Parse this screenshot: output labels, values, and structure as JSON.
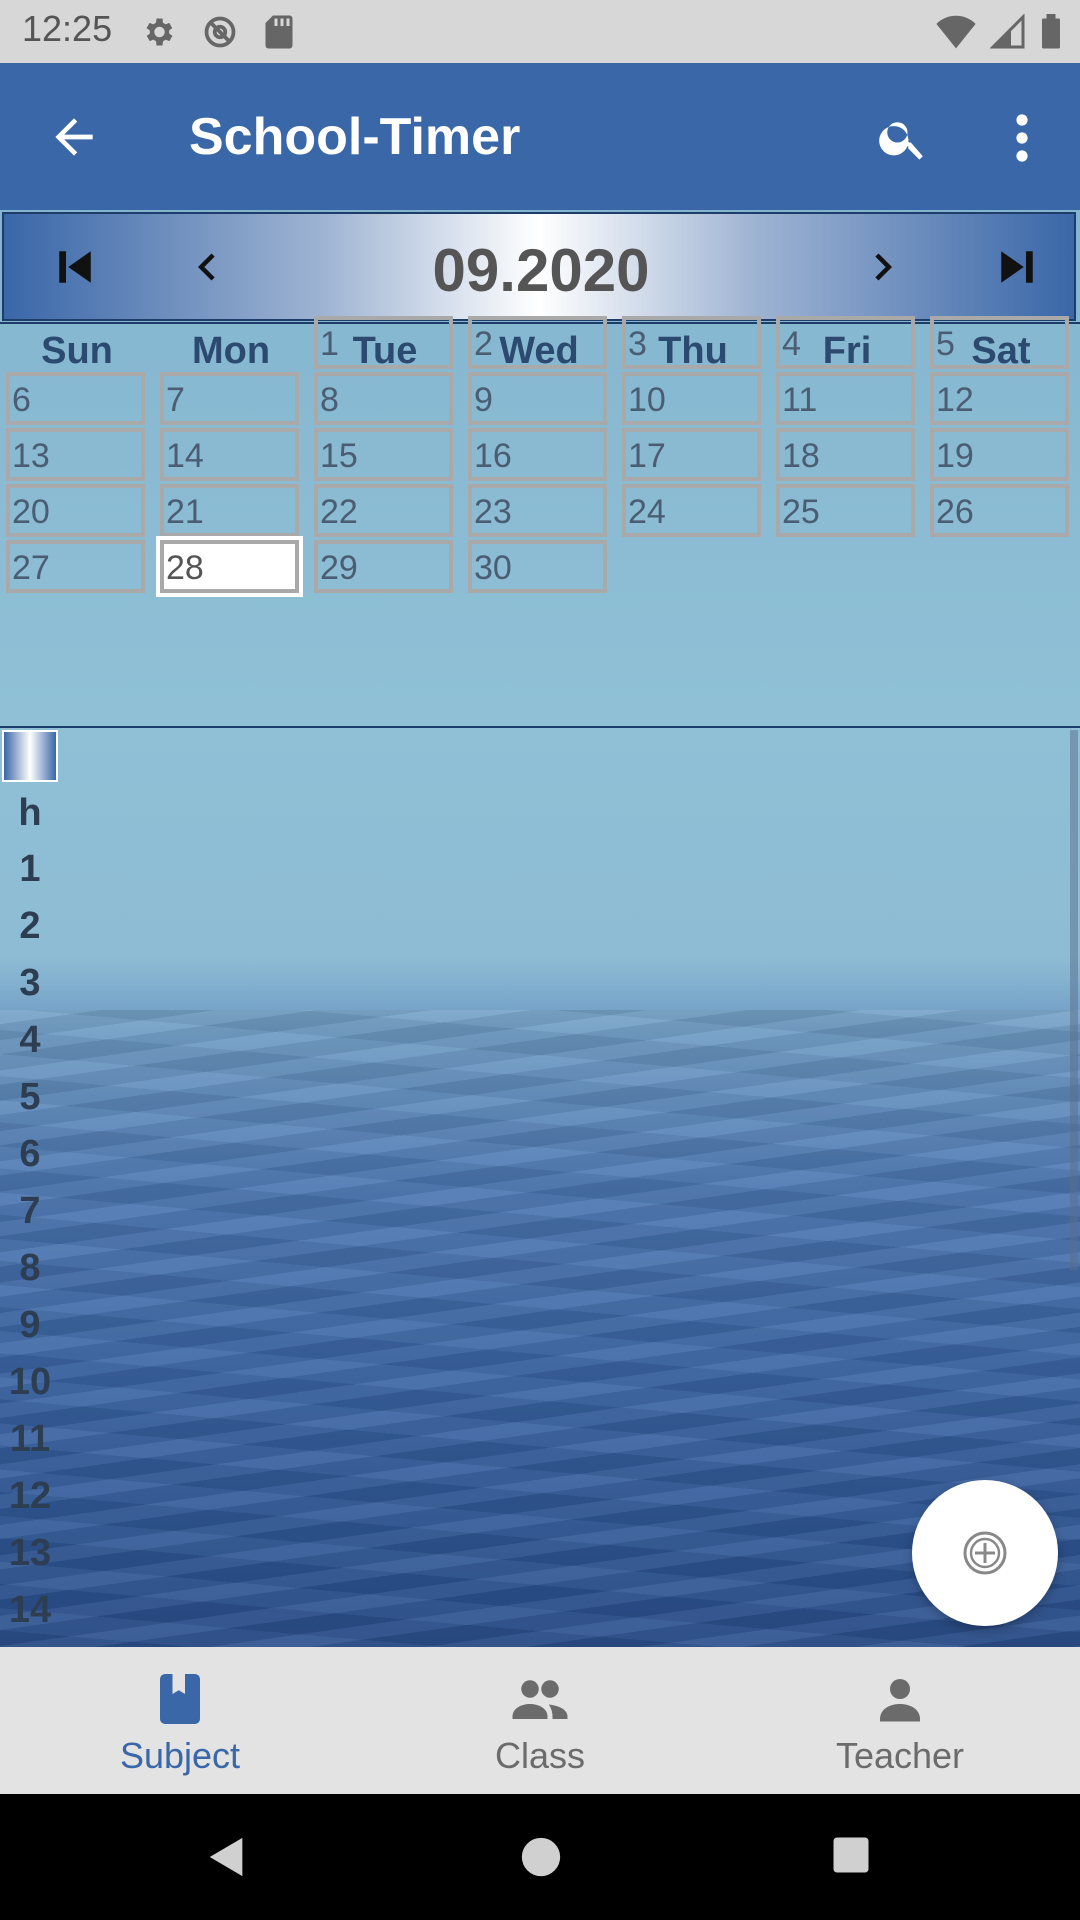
{
  "status_bar": {
    "time": "12:25"
  },
  "app_bar": {
    "title": "School-Timer"
  },
  "calendar": {
    "month_label": "09.2020",
    "weekdays": [
      "Sun",
      "Mon",
      "Tue",
      "Wed",
      "Thu",
      "Fri",
      "Sat"
    ],
    "days": [
      "1",
      "2",
      "3",
      "4",
      "5",
      "6",
      "7",
      "8",
      "9",
      "10",
      "11",
      "12",
      "13",
      "14",
      "15",
      "16",
      "17",
      "18",
      "19",
      "20",
      "21",
      "22",
      "23",
      "24",
      "25",
      "26",
      "27",
      "28",
      "29",
      "30"
    ],
    "selected_day": "28"
  },
  "hours": {
    "header": "h",
    "items": [
      "1",
      "2",
      "3",
      "4",
      "5",
      "6",
      "7",
      "8",
      "9",
      "10",
      "11",
      "12",
      "13",
      "14"
    ]
  },
  "bottom_nav": [
    {
      "label": "Subject",
      "icon": "book-icon",
      "active": true
    },
    {
      "label": "Class",
      "icon": "group-icon",
      "active": false
    },
    {
      "label": "Teacher",
      "icon": "person-icon",
      "active": false
    }
  ],
  "colors": {
    "primary": "#3a67a8",
    "active_tab": "#3a67a8",
    "inactive_tab": "#6b6b6b"
  }
}
